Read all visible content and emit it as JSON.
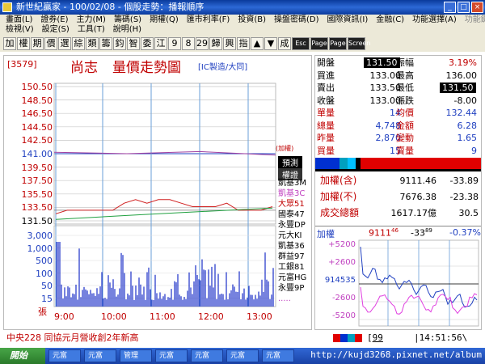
{
  "window": {
    "title": "新世紀贏家 - 100/02/08 - 個股走勢：播報順序",
    "min": "_",
    "max": "□",
    "close": "×"
  },
  "menu": {
    "row1": [
      "畫面(L)",
      "證券(E)",
      "主力(M)",
      "籌碼(S)",
      "期權(Q)",
      "匯市利率(F)",
      "投資(B)",
      "操盤密碼(D)",
      "國際資訊(I)",
      "金融(C)",
      "功能選擇(A)",
      "功能鍵(U)"
    ],
    "row2": [
      "檢視(V)",
      "設定(S)",
      "工具(T)",
      "說明(H)"
    ]
  },
  "toolbar": {
    "chars": [
      "加",
      "權",
      "期",
      "價",
      "選",
      "綜",
      "類",
      "籌",
      "鈞",
      "智",
      "委",
      "江",
      "9",
      "8",
      "29",
      "歸",
      "興",
      "指",
      "▲",
      "▼",
      "成"
    ],
    "dark": [
      "Esc",
      "Page",
      "Page",
      "Screen"
    ]
  },
  "chart": {
    "code": "[3579]",
    "name": "尚志",
    "title": "量價走勢圖",
    "industry": "[IC製造/大同]",
    "price_ticks": [
      "150.50",
      "148.50",
      "146.50",
      "144.50",
      "142.50",
      "141.00",
      "139.50",
      "137.50",
      "135.50",
      "133.50",
      "131.50"
    ],
    "vol_ticks": [
      "3,000",
      "1,000",
      "500",
      "100",
      "50",
      "15"
    ],
    "vol_unit": "張",
    "time_ticks": [
      "9:00",
      "10:00",
      "11:00",
      "12:00",
      "13:00"
    ],
    "overlay_label": "(加權)",
    "side_tags": [
      "預測",
      "權證"
    ],
    "warrants": [
      "凱基3M",
      "凱基3C",
      "大眾51",
      "國泰47",
      "永豐DP",
      "元大KI",
      "凱基36",
      "群益97",
      "工銀81",
      "元富HG",
      "永豐9P",
      "....."
    ]
  },
  "chart_data": {
    "type": "line",
    "x_range": [
      "9:00",
      "13:30"
    ],
    "ylim": [
      131.5,
      150.5
    ],
    "reference": {
      "price": 133.0
    },
    "series": [
      {
        "values": [
          132.5,
          133.0,
          133.0,
          133.0,
          133.0,
          133.0,
          134.0,
          134.5,
          134.0,
          134.5,
          134.5,
          134.0,
          133.5,
          133.5,
          133.5,
          134.0,
          133.0,
          133.0,
          133.0,
          133.5
        ]
      }
    ]
  },
  "quote": {
    "rows": [
      [
        {
          "label": "開盤",
          "value": "131.50",
          "boxed": true
        },
        {
          "label": "振幅",
          "value": "3.19%"
        }
      ],
      [
        {
          "label": "買進",
          "value": "133.00"
        },
        {
          "label": "最高",
          "value": "136.00"
        }
      ],
      [
        {
          "label": "賣出",
          "value": "133.50"
        },
        {
          "label": "最低",
          "value": "131.50",
          "boxed": true
        }
      ],
      [
        {
          "label": "收盤",
          "value": "133.00"
        },
        {
          "label": "漲跌",
          "value": "-8.00"
        }
      ],
      [
        {
          "label": "單量",
          "value": "14"
        },
        {
          "label": "均價",
          "value": "132.44"
        }
      ],
      [
        {
          "label": "總量",
          "value": "4,748"
        },
        {
          "label": "金額",
          "value": "6.28"
        }
      ],
      [
        {
          "label": "昨量",
          "value": "2,870"
        },
        {
          "label": "變動",
          "value": "1.65"
        }
      ],
      [
        {
          "label": "買量",
          "value": "15"
        },
        {
          "label": "賣量",
          "value": "9"
        }
      ]
    ]
  },
  "index": {
    "rows": [
      {
        "label": "加權(含)",
        "value": "9111.46",
        "change": "-33.89"
      },
      {
        "label": "加權(不)",
        "value": "7676.38",
        "change": "-23.38"
      },
      {
        "label": "成交總額",
        "value": "1617.17億",
        "change": "30.5"
      }
    ],
    "mini": {
      "label": "加權",
      "value": "9111",
      "value_sup": "46",
      "change": "-33",
      "change_sup": "89",
      "pct": "-0.37%",
      "ticks": [
        "+5200",
        "+2600",
        "914535",
        "-2600",
        "-5200"
      ]
    }
  },
  "status": {
    "news": "中央228  同協元月營收創2年新高",
    "input": "99",
    "time": "14:51:56"
  },
  "taskbar": {
    "start": "開始",
    "tasks": [
      "元富",
      "元富",
      "管理",
      "元富",
      "元富",
      "元富",
      "元富"
    ]
  },
  "watermark": "http://kujd3268.pixnet.net/album"
}
